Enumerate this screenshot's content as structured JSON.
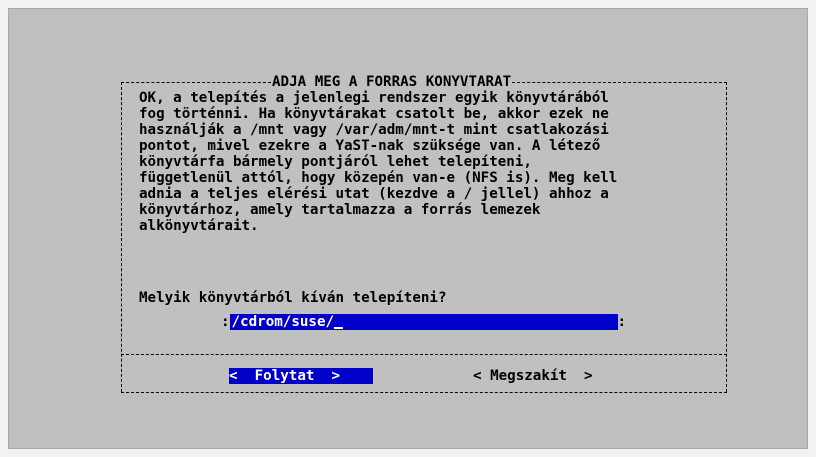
{
  "dialog": {
    "title": "ADJA MEG A FORRAS KONYVTARAT",
    "body_lines": [
      "OK, a telepítés a jelenlegi rendszer egyik könyvtárából",
      "fog történni. Ha könyvtárakat csatolt be, akkor ezek ne",
      "használják a /mnt vagy /var/adm/mnt-t mint csatlakozási",
      "pontot, mivel ezekre a YaST-nak szüksége van. A létező",
      "könyvtárfa bármely pontjáról lehet telepíteni,",
      "függetlenül attól, hogy közepén van-e (NFS is). Meg kell",
      "adnia a teljes elérési utat (kezdve a / jellel) ahhoz a",
      "könyvtárhoz, amely tartalmazza a forrás lemezek",
      "alkönyvtárait."
    ],
    "prompt": "Melyik könyvtárból kíván telepíteni?",
    "input": {
      "value": "/cdrom/suse/"
    },
    "buttons": {
      "continue": "<  Folytat  >",
      "cancel": "< Megszakít  >"
    }
  },
  "colors": {
    "background": "#bfbfbf",
    "highlight": "#0000c8",
    "highlight_text": "#ffffff"
  }
}
